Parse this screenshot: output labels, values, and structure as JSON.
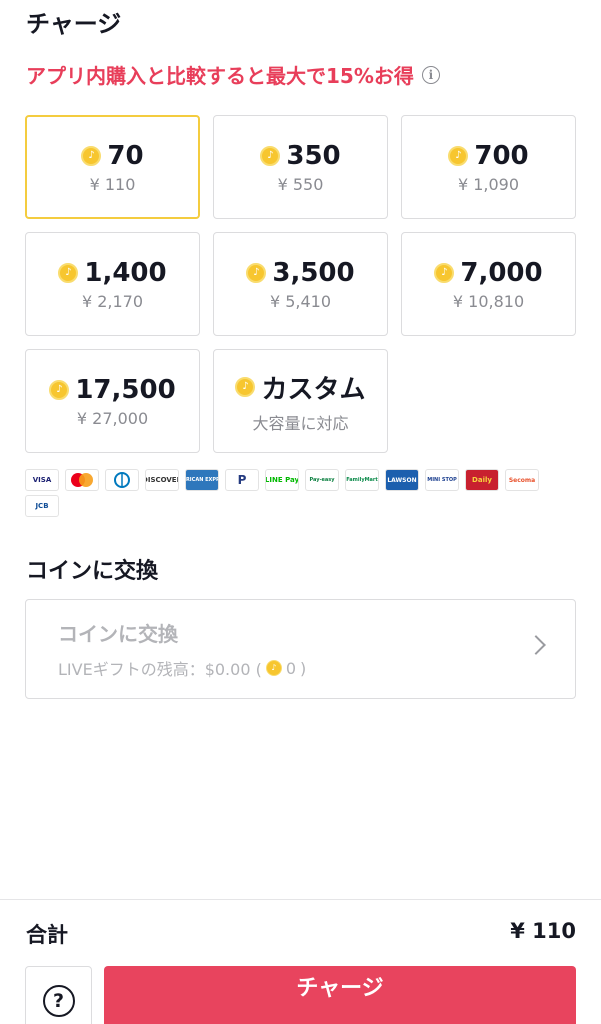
{
  "header": {
    "title": "チャージ"
  },
  "promo": {
    "text": "アプリ内購入と比較すると最大で15%お得",
    "color": "#e83e5a"
  },
  "packages": [
    {
      "amount": "70",
      "price": "¥ 110",
      "selected": true
    },
    {
      "amount": "350",
      "price": "¥ 550"
    },
    {
      "amount": "700",
      "price": "¥ 1,090"
    },
    {
      "amount": "1,400",
      "price": "¥ 2,170"
    },
    {
      "amount": "3,500",
      "price": "¥ 5,410"
    },
    {
      "amount": "7,000",
      "price": "¥ 10,810"
    },
    {
      "amount": "17,500",
      "price": "¥ 27,000"
    },
    {
      "amount": "カスタム",
      "price": "大容量に対応"
    }
  ],
  "payment_methods": [
    "VISA",
    "",
    "",
    "DISCOVER",
    "AMERICAN EXPRESS",
    "P",
    "LINE Pay",
    "Pay-easy",
    "FamilyMart",
    "LAWSON",
    "MINI STOP",
    "Daily",
    "Secoma",
    "JCB"
  ],
  "exchange": {
    "section_title": "コインに交換",
    "card_title": "コインに交換",
    "balance_prefix": "LIVEギフトの残高：$0.00 (",
    "balance_coins": "0",
    "balance_suffix": ")"
  },
  "footer": {
    "total_label": "合計",
    "total_value": "¥ 110",
    "charge_label": "チャージ"
  },
  "colors": {
    "accent": "#e8445e",
    "selected_border": "#f4cc3f",
    "coin": "#f7c62f"
  }
}
